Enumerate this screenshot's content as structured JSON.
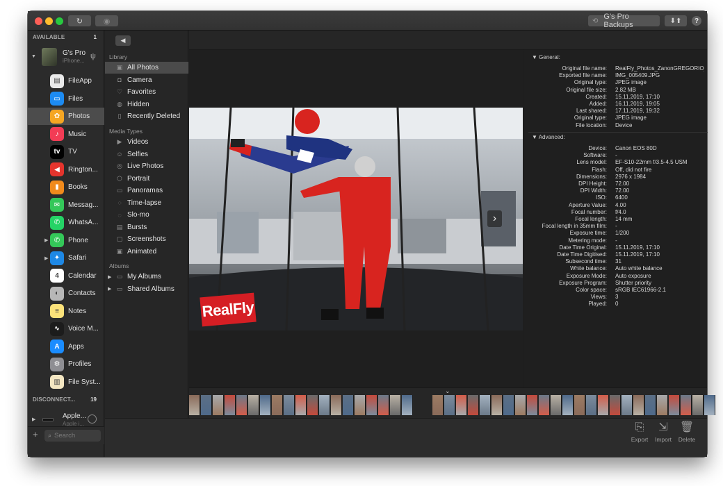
{
  "titlebar": {
    "backup_label": "G's Pro Backups",
    "refresh_icon": "refresh-icon",
    "eye_icon": "eye-icon",
    "sort_icon": "sort-arrows-icon",
    "help_label": "?"
  },
  "device_sidebar": {
    "available_label": "AVAILABLE",
    "available_count": "1",
    "device": {
      "name": "G's Pro",
      "subtitle": "iPhone..."
    },
    "apps": [
      {
        "label": "FileApp",
        "icon": "fileapp-icon",
        "color": "#e9e9e9"
      },
      {
        "label": "Files",
        "icon": "files-icon",
        "color": "#1d8bf2"
      },
      {
        "label": "Photos",
        "icon": "photos-icon",
        "color": "#f5a623"
      },
      {
        "label": "Music",
        "icon": "music-icon",
        "color": "#f23c55"
      },
      {
        "label": "TV",
        "icon": "tv-icon",
        "color": "#000000"
      },
      {
        "label": "Rington...",
        "icon": "ringtones-icon",
        "color": "#e5342d"
      },
      {
        "label": "Books",
        "icon": "books-icon",
        "color": "#f08a1c"
      },
      {
        "label": "Messag...",
        "icon": "messages-icon",
        "color": "#34c759"
      },
      {
        "label": "WhatsA...",
        "icon": "whatsapp-icon",
        "color": "#25d366"
      },
      {
        "label": "Phone",
        "icon": "phone-icon",
        "color": "#34c759"
      },
      {
        "label": "Safari",
        "icon": "safari-icon",
        "color": "#1e88e5"
      },
      {
        "label": "Calendar",
        "icon": "calendar-icon",
        "color": "#ffffff"
      },
      {
        "label": "Contacts",
        "icon": "contacts-icon",
        "color": "#b7b7b7"
      },
      {
        "label": "Notes",
        "icon": "notes-icon",
        "color": "#fbe27a"
      },
      {
        "label": "Voice M...",
        "icon": "voice-memos-icon",
        "color": "#1c1c1c"
      },
      {
        "label": "Apps",
        "icon": "app-store-icon",
        "color": "#1a8cff"
      },
      {
        "label": "Profiles",
        "icon": "profiles-icon",
        "color": "#8e8e93"
      },
      {
        "label": "File Syst...",
        "icon": "file-system-icon",
        "color": "#f3e6c2"
      }
    ],
    "calendar_day": "4",
    "tv_mark": "tv",
    "disconnected_label": "DISCONNECT...",
    "disconnected_count": "19",
    "disconnected_device": {
      "name": "Apple...",
      "subtitle": "Apple i..."
    },
    "search_placeholder": "Search"
  },
  "library": {
    "library_heading": "Library",
    "library_items": [
      {
        "label": "All Photos",
        "icon": "all-photos-icon"
      },
      {
        "label": "Camera",
        "icon": "camera-icon"
      },
      {
        "label": "Favorites",
        "icon": "heart-icon"
      },
      {
        "label": "Hidden",
        "icon": "hidden-icon"
      },
      {
        "label": "Recently Deleted",
        "icon": "trash-icon"
      }
    ],
    "media_heading": "Media Types",
    "media_items": [
      {
        "label": "Videos",
        "icon": "video-icon"
      },
      {
        "label": "Selfies",
        "icon": "selfie-icon"
      },
      {
        "label": "Live Photos",
        "icon": "live-photo-icon"
      },
      {
        "label": "Portrait",
        "icon": "portrait-icon"
      },
      {
        "label": "Panoramas",
        "icon": "panorama-icon"
      },
      {
        "label": "Time-lapse",
        "icon": "timelapse-icon"
      },
      {
        "label": "Slo-mo",
        "icon": "slomo-icon"
      },
      {
        "label": "Bursts",
        "icon": "burst-icon"
      },
      {
        "label": "Screenshots",
        "icon": "screenshot-icon"
      },
      {
        "label": "Animated",
        "icon": "animated-icon"
      }
    ],
    "albums_heading": "Albums",
    "album_items": [
      {
        "label": "My Albums",
        "icon": "folder-icon"
      },
      {
        "label": "Shared Albums",
        "icon": "folder-icon"
      }
    ]
  },
  "viewer": {
    "logo_text": "RealFly",
    "next_icon": "chevron-right-icon"
  },
  "info": {
    "general_heading": "General:",
    "general": [
      {
        "key": "Original file name:",
        "value": "RealFly_Photos_ZanonGREGORIO_..."
      },
      {
        "key": "Exported file name:",
        "value": "IMG_005409.JPG"
      },
      {
        "key": "Original type:",
        "value": "JPEG image"
      },
      {
        "key": "Original file size:",
        "value": "2.82 MB"
      },
      {
        "key": "Created:",
        "value": "15.11.2019, 17:10"
      },
      {
        "key": "Added:",
        "value": "16.11.2019, 19:05"
      },
      {
        "key": "Last shared:",
        "value": "17.11.2019, 19:32"
      },
      {
        "key": "Original type:",
        "value": "JPEG image"
      },
      {
        "key": "File location:",
        "value": "Device"
      }
    ],
    "advanced_heading": "Advanced:",
    "advanced": [
      {
        "key": "Device:",
        "value": "Canon EOS 80D"
      },
      {
        "key": "Software:",
        "value": "-"
      },
      {
        "key": "Lens model:",
        "value": "EF-S10-22mm f/3.5-4.5 USM"
      },
      {
        "key": "Flash:",
        "value": "Off, did not fire"
      },
      {
        "key": "Dimensions:",
        "value": "2976 x 1984"
      },
      {
        "key": "DPI Height:",
        "value": "72.00"
      },
      {
        "key": "DPI Width:",
        "value": "72.00"
      },
      {
        "key": "ISO:",
        "value": "6400"
      },
      {
        "key": "Aperture Value:",
        "value": "4.00"
      },
      {
        "key": "Focal number:",
        "value": "f/4.0"
      },
      {
        "key": "Focal length:",
        "value": "14 mm"
      },
      {
        "key": "Focal length in 35mm film:",
        "value": "-"
      },
      {
        "key": "Exposure time:",
        "value": "1/200"
      },
      {
        "key": "Metering mode:",
        "value": "-"
      },
      {
        "key": "Date Time Original:",
        "value": "15.11.2019, 17:10"
      },
      {
        "key": "Date Time Digitised:",
        "value": "15.11.2019, 17:10"
      },
      {
        "key": "Subsecond time:",
        "value": "31"
      },
      {
        "key": "White balance:",
        "value": "Auto white balance"
      },
      {
        "key": "Exposure Mode:",
        "value": "Auto exposure"
      },
      {
        "key": "Exposure Program:",
        "value": "Shutter priority"
      },
      {
        "key": "Color space:",
        "value": "sRGB IEC61966-2.1"
      },
      {
        "key": "Views:",
        "value": "3"
      },
      {
        "key": "Played:",
        "value": "0"
      }
    ]
  },
  "toolbar": {
    "export_label": "Export",
    "import_label": "Import",
    "delete_label": "Delete"
  }
}
